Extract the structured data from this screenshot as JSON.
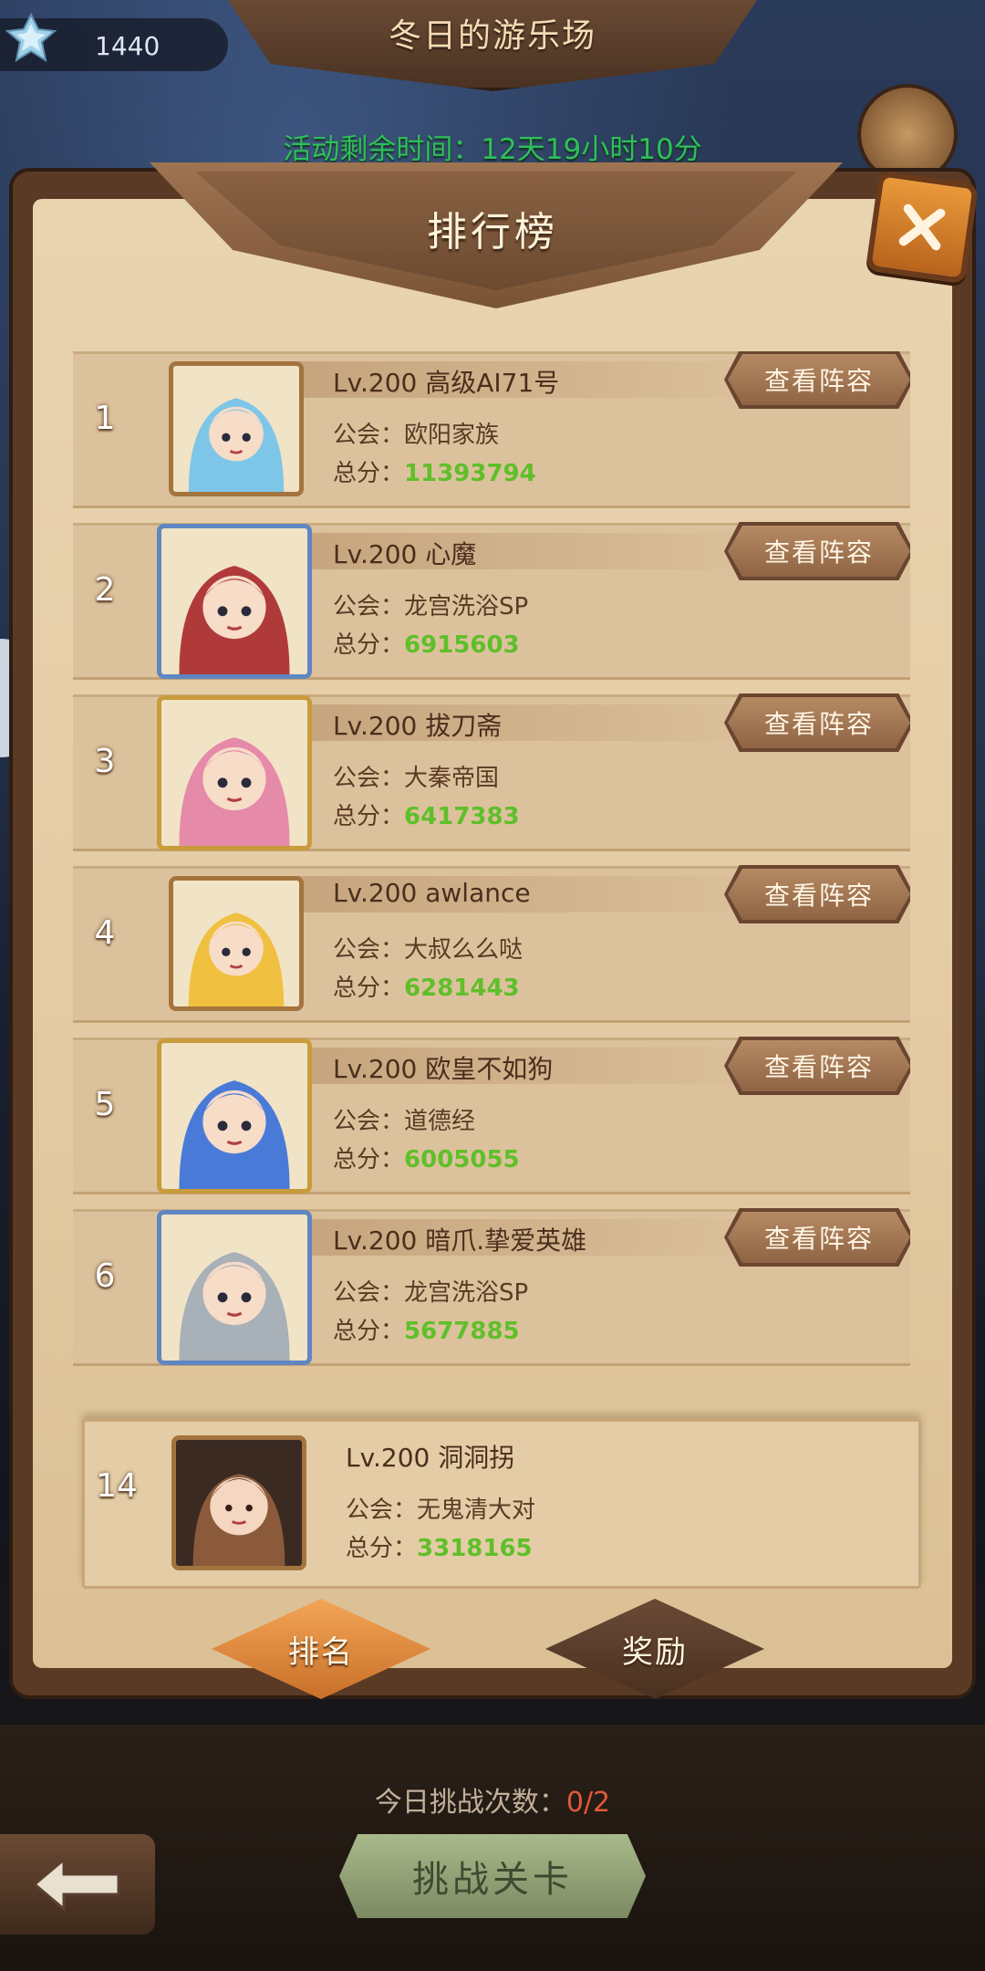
{
  "header": {
    "title": "冬日的游乐场",
    "currency_value": "1440",
    "event_time": "活动剩余时间：12天19小时10分"
  },
  "panel": {
    "title": "排行榜",
    "view_button_label": "查看阵容",
    "guild_prefix": "公会：",
    "score_prefix": "总分："
  },
  "rankings": [
    {
      "rank": "1",
      "name": "Lv.200  高级AI71号",
      "guild": "欧阳家族",
      "score": "11393794",
      "frame": "plain",
      "accent": "#7ec6e8"
    },
    {
      "rank": "2",
      "name": "Lv.200  心魔",
      "guild": "龙宫洗浴SP",
      "score": "6915603",
      "frame": "blue",
      "accent": "#b03a3a"
    },
    {
      "rank": "3",
      "name": "Lv.200  拔刀斋",
      "guild": "大秦帝国",
      "score": "6417383",
      "frame": "gold",
      "accent": "#e58aa8"
    },
    {
      "rank": "4",
      "name": "Lv.200  awlance",
      "guild": "大叔么么哒",
      "score": "6281443",
      "frame": "plain",
      "accent": "#f0c040"
    },
    {
      "rank": "5",
      "name": "Lv.200  欧皇不如狗",
      "guild": "道德经",
      "score": "6005055",
      "frame": "gold",
      "accent": "#4a7ad8"
    },
    {
      "rank": "6",
      "name": "Lv.200  暗爪.挚爱英雄",
      "guild": "龙宫洗浴SP",
      "score": "5677885",
      "frame": "blue",
      "accent": "#a8b0b8"
    }
  ],
  "self": {
    "rank": "14",
    "name": "Lv.200  洞洞拐",
    "guild": "无鬼清大对",
    "score": "3318165",
    "accent": "#8a5a3a"
  },
  "tabs": {
    "ranking": "排名",
    "reward": "奖励"
  },
  "footer": {
    "attempts_label": "今日挑战次数：",
    "attempts_value": "0/2",
    "challenge_label": "挑战关卡"
  },
  "icons": {
    "currency": "crystal-icon",
    "close": "close-icon",
    "back": "back-arrow-icon"
  },
  "colors": {
    "accent_orange": "#e9993a",
    "score_green": "#5fbf2a",
    "event_green": "#2fbf5a",
    "parchment": "#e9d4b0"
  }
}
